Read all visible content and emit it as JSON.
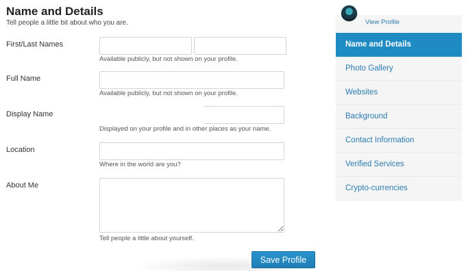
{
  "header": {
    "title": "Name and Details",
    "subtitle": "Tell people a little bit about who you are."
  },
  "form": {
    "first_last": {
      "label": "First/Last Names",
      "first_value": "",
      "last_value": "",
      "hint": "Available publicly, but not shown on your profile."
    },
    "full_name": {
      "label": "Full Name",
      "value": "",
      "hint": "Available publicly, but not shown on your profile."
    },
    "display_name": {
      "label": "Display Name",
      "value": "",
      "hint": "Displayed on your profile and in other places as your name."
    },
    "location": {
      "label": "Location",
      "value": "",
      "hint": "Where in the world are you?"
    },
    "about_me": {
      "label": "About Me",
      "value": "",
      "hint": "Tell people a little about yourself."
    },
    "save_label": "Save Profile"
  },
  "profile": {
    "avatar_icon": "user-avatar",
    "view_profile_label": "View Profile"
  },
  "sidebar": {
    "items": [
      {
        "label": "Name and Details",
        "active": true
      },
      {
        "label": "Photo Gallery",
        "active": false
      },
      {
        "label": "Websites",
        "active": false
      },
      {
        "label": "Background",
        "active": false
      },
      {
        "label": "Contact Information",
        "active": false
      },
      {
        "label": "Verified Services",
        "active": false
      },
      {
        "label": "Crypto-currencies",
        "active": false
      }
    ]
  },
  "colors": {
    "accent": "#1e8bc3",
    "link": "#2a7ab0",
    "sidebar_bg": "#f5f5f5"
  }
}
